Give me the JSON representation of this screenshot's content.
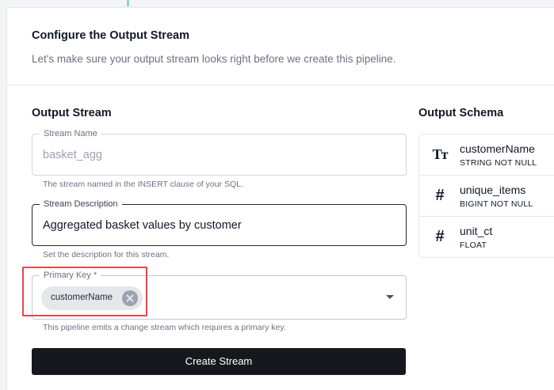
{
  "header": {
    "title": "Configure the Output Stream",
    "subtitle": "Let's make sure your output stream looks right before we create this pipeline."
  },
  "output_stream": {
    "section_title": "Output Stream",
    "stream_name": {
      "label": "Stream Name",
      "value": "basket_agg",
      "helper": "The stream named in the INSERT clause of your SQL."
    },
    "stream_description": {
      "label": "Stream Description",
      "value": "Aggregated basket values by customer",
      "helper": "Set the description for this stream."
    },
    "primary_key": {
      "label": "Primary Key *",
      "chip": "customerName",
      "helper": "This pipeline emits a change stream which requires a primary key."
    },
    "create_button": "Create Stream"
  },
  "output_schema": {
    "section_title": "Output Schema",
    "columns": [
      {
        "icon": "Tт",
        "icon_name": "text-type-icon",
        "name": "customerName",
        "type": "STRING NOT NULL"
      },
      {
        "icon": "#",
        "icon_name": "number-type-icon",
        "name": "unique_items",
        "type": "BIGINT NOT NULL"
      },
      {
        "icon": "#",
        "icon_name": "number-type-icon",
        "name": "unit_ct",
        "type": "FLOAT"
      }
    ]
  },
  "colors": {
    "accent": "#7fe0c4",
    "highlight": "#e5484d",
    "button_bg": "#16181d"
  }
}
